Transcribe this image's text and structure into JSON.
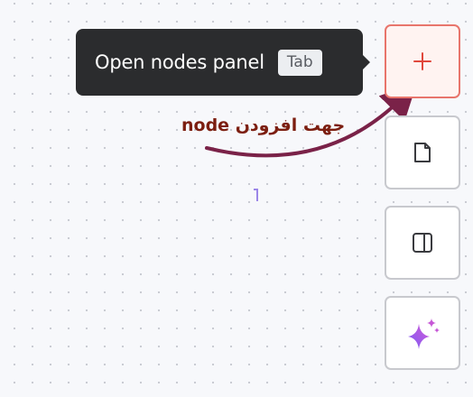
{
  "tooltip": {
    "label": "Open nodes panel",
    "shortcut": "Tab"
  },
  "annotation": {
    "text": "جهت افزودن node",
    "color": "#7c1e10",
    "arrow_color": "#7a2248"
  },
  "toolbar": {
    "buttons": [
      {
        "name": "add-node-button",
        "icon": "plus-icon",
        "active": true
      },
      {
        "name": "sticky-note-button",
        "icon": "note-icon",
        "active": false
      },
      {
        "name": "toggle-panel-button",
        "icon": "panel-icon",
        "active": false
      },
      {
        "name": "ai-assistant-button",
        "icon": "sparkle-icon",
        "active": false
      }
    ]
  },
  "colors": {
    "accent": "#e8756c",
    "canvas": "#f7f8fb",
    "tooltip_bg": "#2b2c2e"
  }
}
